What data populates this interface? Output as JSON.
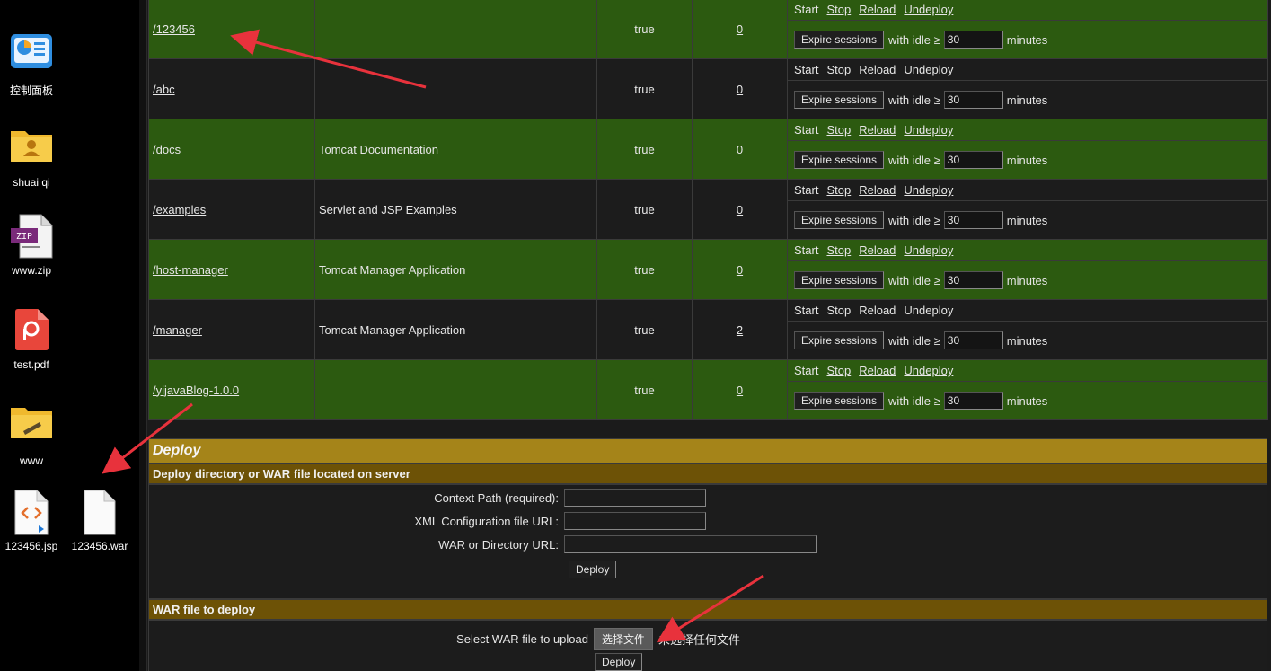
{
  "desktop": {
    "icons": [
      {
        "label": "控制面板"
      },
      {
        "label": "shuai qi"
      },
      {
        "label": "www.zip",
        "badge": "ZIP"
      },
      {
        "label": "test.pdf"
      },
      {
        "label": "www"
      },
      {
        "label": "123456.jsp"
      },
      {
        "label": "123456.war"
      }
    ]
  },
  "apps": {
    "commands": {
      "start": "Start",
      "stop": "Stop",
      "reload": "Reload",
      "undeploy": "Undeploy",
      "expire": "Expire sessions",
      "with_idle": "with idle ≥",
      "minutes": "minutes"
    },
    "rows": [
      {
        "path": "/123456",
        "name": "",
        "running": "true",
        "sessions": "0",
        "idle": "30"
      },
      {
        "path": "/abc",
        "name": "",
        "running": "true",
        "sessions": "0",
        "idle": "30"
      },
      {
        "path": "/docs",
        "name": "Tomcat Documentation",
        "running": "true",
        "sessions": "0",
        "idle": "30"
      },
      {
        "path": "/examples",
        "name": "Servlet and JSP Examples",
        "running": "true",
        "sessions": "0",
        "idle": "30"
      },
      {
        "path": "/host-manager",
        "name": "Tomcat Manager Application",
        "running": "true",
        "sessions": "0",
        "idle": "30"
      },
      {
        "path": "/manager",
        "name": "Tomcat Manager Application",
        "running": "true",
        "sessions": "2",
        "idle": "30"
      },
      {
        "path": "/yijavaBlog-1.0.0",
        "name": "",
        "running": "true",
        "sessions": "0",
        "idle": "30"
      }
    ]
  },
  "deploy": {
    "title": "Deploy",
    "server_section": {
      "heading": "Deploy directory or WAR file located on server",
      "context_label": "Context Path (required):",
      "xml_label": "XML Configuration file URL:",
      "war_label": "WAR or Directory URL:",
      "deploy_button": "Deploy"
    },
    "upload_section": {
      "heading": "WAR file to deploy",
      "select_label": "Select WAR file to upload",
      "choose_button": "选择文件",
      "no_file": "未选择任何文件",
      "deploy_button": "Deploy"
    }
  },
  "colors": {
    "row_green": "#2c5a10",
    "row_dark": "#1c1c1c",
    "deploy_gold": "#a58419",
    "section_brown": "#6d5206",
    "arrow_red": "#e8323c"
  }
}
